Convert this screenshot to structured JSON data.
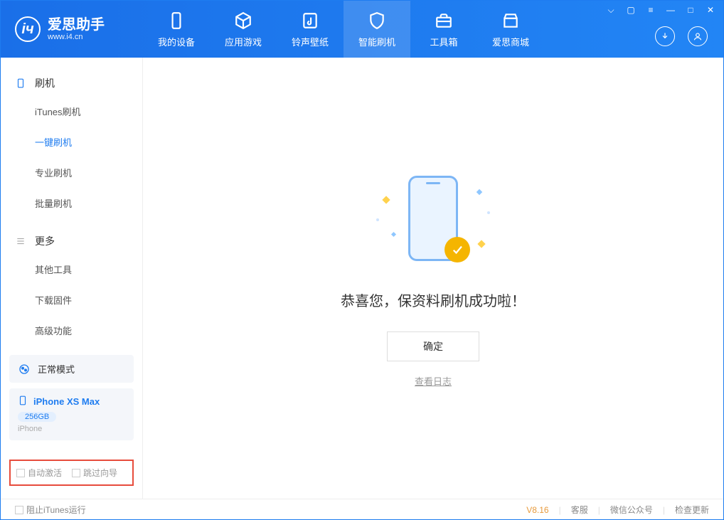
{
  "app": {
    "title": "爱思助手",
    "subtitle": "www.i4.cn"
  },
  "nav": {
    "tabs": [
      {
        "label": "我的设备"
      },
      {
        "label": "应用游戏"
      },
      {
        "label": "铃声壁纸"
      },
      {
        "label": "智能刷机"
      },
      {
        "label": "工具箱"
      },
      {
        "label": "爱思商城"
      }
    ]
  },
  "sidebar": {
    "group1": {
      "label": "刷机"
    },
    "items1": [
      {
        "label": "iTunes刷机"
      },
      {
        "label": "一键刷机"
      },
      {
        "label": "专业刷机"
      },
      {
        "label": "批量刷机"
      }
    ],
    "group2": {
      "label": "更多"
    },
    "items2": [
      {
        "label": "其他工具"
      },
      {
        "label": "下载固件"
      },
      {
        "label": "高级功能"
      }
    ]
  },
  "device": {
    "mode": "正常模式",
    "name": "iPhone XS Max",
    "capacity": "256GB",
    "type": "iPhone"
  },
  "checks": {
    "autoActivate": "自动激活",
    "skipGuide": "跳过向导"
  },
  "main": {
    "successMsg": "恭喜您，保资料刷机成功啦！",
    "okBtn": "确定",
    "viewLog": "查看日志"
  },
  "footer": {
    "blockItunes": "阻止iTunes运行",
    "version": "V8.16",
    "support": "客服",
    "wechat": "微信公众号",
    "checkUpdate": "检查更新"
  }
}
